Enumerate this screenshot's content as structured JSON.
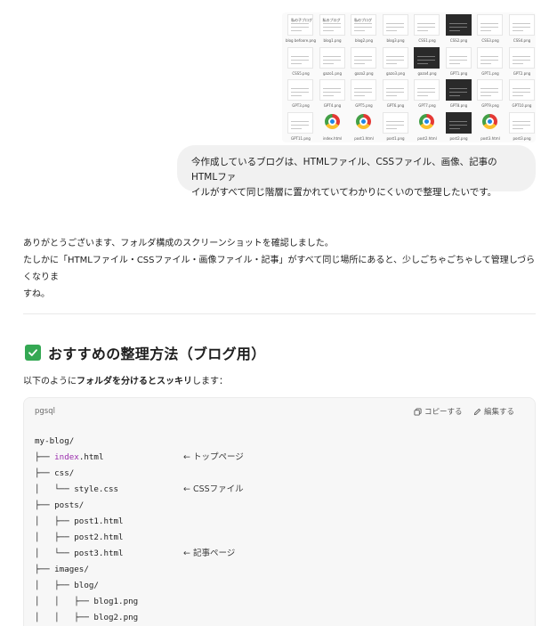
{
  "attachment": {
    "thumbnails": [
      {
        "label": "blog befoore.png",
        "type": "blog",
        "title": "私の子ブログ"
      },
      {
        "label": "blog1.png",
        "type": "blog",
        "title": "私のブログ"
      },
      {
        "label": "blog2.png",
        "type": "blog",
        "title": "私のブログ"
      },
      {
        "label": "blog3.png",
        "type": "doc"
      },
      {
        "label": "CSS1.png",
        "type": "doc"
      },
      {
        "label": "CSS2.png",
        "type": "dark"
      },
      {
        "label": "CSS3.png",
        "type": "doc"
      },
      {
        "label": "CSS4.png",
        "type": "doc"
      },
      {
        "label": "CSS5.png",
        "type": "doc"
      },
      {
        "label": "gazo1.png",
        "type": "doc"
      },
      {
        "label": "gazo2.png",
        "type": "doc"
      },
      {
        "label": "gazo3.png",
        "type": "doc"
      },
      {
        "label": "gazo4.png",
        "type": "dark"
      },
      {
        "label": "GPT1.png",
        "type": "doc"
      },
      {
        "label": "GPT1.png",
        "type": "doc"
      },
      {
        "label": "GPT2.png",
        "type": "doc"
      },
      {
        "label": "GPT3.png",
        "type": "doc"
      },
      {
        "label": "GPT4.png",
        "type": "doc"
      },
      {
        "label": "GPT5.png",
        "type": "doc"
      },
      {
        "label": "GPT6.png",
        "type": "doc"
      },
      {
        "label": "GPT7.png",
        "type": "doc"
      },
      {
        "label": "GPT8.png",
        "type": "dark"
      },
      {
        "label": "GPT9.png",
        "type": "doc"
      },
      {
        "label": "GPT10.png",
        "type": "doc"
      },
      {
        "label": "GPT11.png",
        "type": "doc"
      },
      {
        "label": "index.html",
        "type": "chrome"
      },
      {
        "label": "post1.html",
        "type": "chrome"
      },
      {
        "label": "post1.png",
        "type": "doc"
      },
      {
        "label": "post2.html",
        "type": "chrome"
      },
      {
        "label": "post2.png",
        "type": "dark"
      },
      {
        "label": "post3.html",
        "type": "chrome"
      },
      {
        "label": "post3.png",
        "type": "doc"
      }
    ]
  },
  "user_message": {
    "line1": "今作成しているブログは、HTMLファイル、CSSファイル、画像、記事のHTMLファ",
    "line2": "イルがすべて同じ階層に置かれていてわかりにくいので整理したいです。"
  },
  "answer": {
    "line1": "ありがとうございます、フォルダ構成のスクリーンショットを確認しました。",
    "line2": "たしかに「HTMLファイル・CSSファイル・画像ファイル・記事」がすべて同じ場所にあると、少しごちゃごちゃして管理しづらくなりま",
    "line3": "すね。"
  },
  "section": {
    "title": "おすすめの整理方法（ブログ用）",
    "intro_prefix": "以下のように",
    "intro_bold": "フォルダを分けるとスッキリ",
    "intro_suffix": "します："
  },
  "code": {
    "language": "pgsql",
    "copy_label": "コピーする",
    "edit_label": "編集する",
    "lines": [
      {
        "text": "my-blog/",
        "comment": ""
      },
      {
        "prefix": "├── ",
        "kw": "index",
        "text": ".html",
        "comment": "← トップページ"
      },
      {
        "text": "├── css/",
        "comment": ""
      },
      {
        "text": "│   └── style.css",
        "comment": "← CSSファイル"
      },
      {
        "text": "├── posts/",
        "comment": ""
      },
      {
        "text": "│   ├── post1.html",
        "comment": ""
      },
      {
        "text": "│   ├── post2.html",
        "comment": ""
      },
      {
        "text": "│   └── post3.html",
        "comment": "← 記事ページ"
      },
      {
        "text": "├── images/",
        "comment": ""
      },
      {
        "text": "│   ├── blog/",
        "comment": ""
      },
      {
        "text": "│   │   ├── blog1.png",
        "comment": ""
      },
      {
        "text": "│   │   ├── blog2.png",
        "comment": ""
      }
    ]
  },
  "colors": {
    "check_green": "#34a853",
    "keyword_purple": "#9b2fae",
    "bubble_bg": "#f1f1f1"
  }
}
